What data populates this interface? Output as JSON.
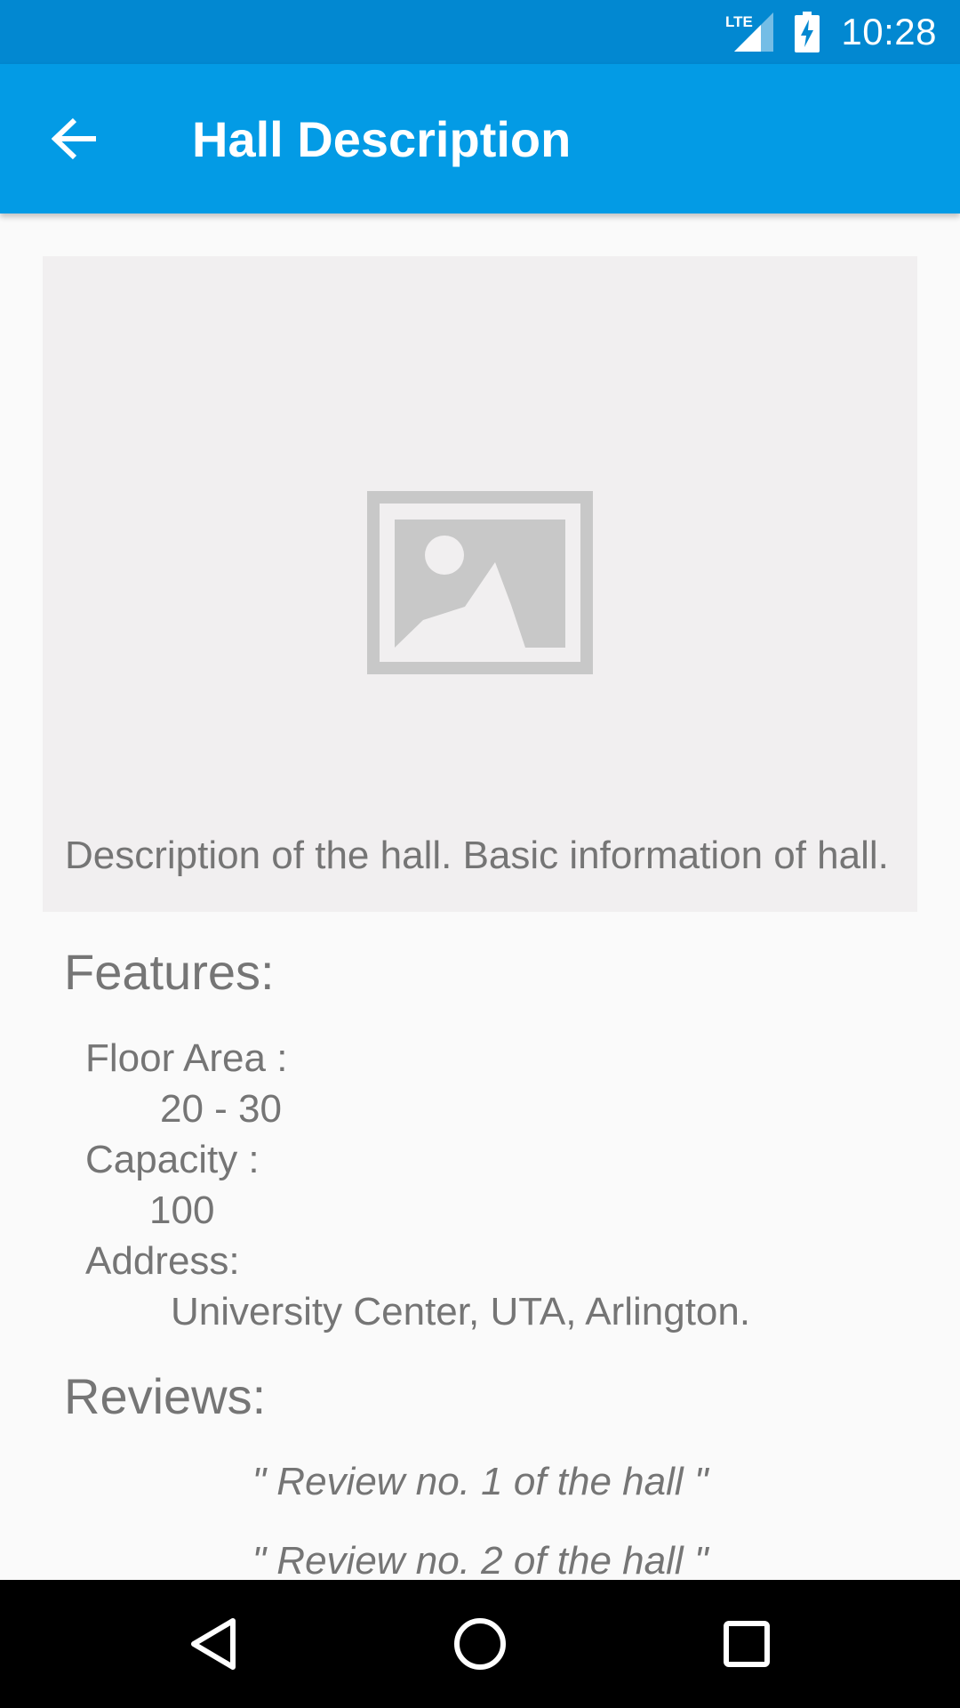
{
  "status_bar": {
    "network_label": "LTE",
    "time": "10:28",
    "icons": [
      "lte-signal-icon",
      "battery-charging-icon"
    ]
  },
  "app_bar": {
    "title": "Hall Description",
    "back_icon": "arrow-back-icon"
  },
  "hall": {
    "image_icon": "image-placeholder-icon",
    "description": "Description of the hall. Basic information of hall."
  },
  "features": {
    "heading": "Features:",
    "floor_area_label": "Floor Area :",
    "floor_area_value": "20 - 30",
    "capacity_label": "Capacity :",
    "capacity_value": "100",
    "address_label": "Address:",
    "address_value": "University Center, UTA, Arlington."
  },
  "reviews": {
    "heading": "Reviews:",
    "items": [
      "\" Review no. 1 of the hall \"",
      "\" Review no. 2 of the hall \""
    ]
  },
  "nav_bar": {
    "icons": [
      "back-triangle-icon",
      "home-circle-icon",
      "recents-square-icon"
    ]
  },
  "colors": {
    "status_bar": "#0288d1",
    "app_bar": "#039be5",
    "text_gray": "#757575",
    "card_bg": "#f1eff0"
  }
}
